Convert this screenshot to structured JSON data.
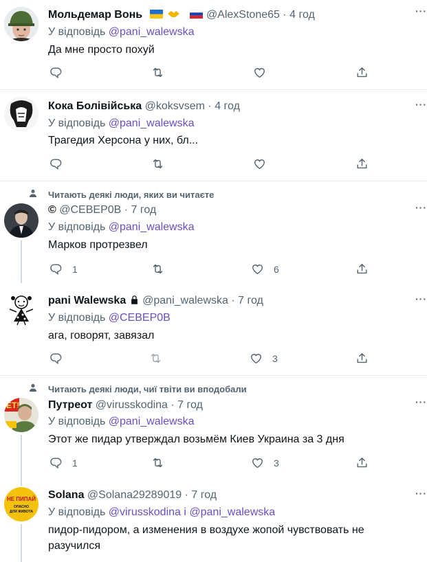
{
  "tweets": [
    {
      "name": "Мольдемар Вонь",
      "handle": "@AlexStone65",
      "time": "4 год",
      "reply_prefix": "У відповідь",
      "reply_to": "@pani_walewska",
      "text": "Да мне просто похуй",
      "replies": "",
      "likes": ""
    },
    {
      "name": "Кока Болівійська",
      "handle": "@koksvsem",
      "time": "4 год",
      "reply_prefix": "У відповідь",
      "reply_to": "@pani_walewska",
      "text": "Трагедия Херсона у них, бл...",
      "replies": "",
      "likes": ""
    },
    {
      "social": "Читають деякі люди, яких ви читаєте",
      "name": "©",
      "handle": "@СЕВЕР0В",
      "time": "7 год",
      "reply_prefix": "У відповідь",
      "reply_to": "@pani_walewska",
      "text": "Марков протрезвел",
      "replies": "1",
      "likes": "6"
    },
    {
      "name": "pani Walewska",
      "handle": "@pani_walewska",
      "time": "7 год",
      "reply_prefix": "У відповідь",
      "reply_to": "@СЕВЕР0В",
      "text": "ага, говорят, завязал",
      "replies": "",
      "likes": "3"
    },
    {
      "social": "Читають деякі люди, чиї твіти ви вподобали",
      "name": "Путреот",
      "handle": "@virusskodina",
      "time": "7 год",
      "reply_prefix": "У відповідь",
      "reply_to": "@pani_walewska",
      "text": "Этот же пидар утверждал возьмём Киев Украина за 3 дня",
      "replies": "1",
      "likes": "3"
    },
    {
      "name": "Solana",
      "handle": "@Solana29289019",
      "time": "7 год",
      "reply_prefix": "У відповідь",
      "reply_to": "@virusskodina",
      "reply_conj": "і",
      "reply_to_2": "@pani_walewska",
      "text_line1": "пидор-пидором, а изменения в воздухе жопой чувствовать не",
      "text_line2": "разучился",
      "avatar_text_1": "НЕ ПИПАЙ",
      "avatar_text_2": "ОПАСНО",
      "avatar_text_3": "ДЛЯ ЖИВОТА"
    }
  ],
  "separator": "·",
  "more_glyph": "···",
  "colors": {
    "link": "#6a4ec4",
    "muted": "#536471",
    "separator": "#e6ecf0"
  }
}
